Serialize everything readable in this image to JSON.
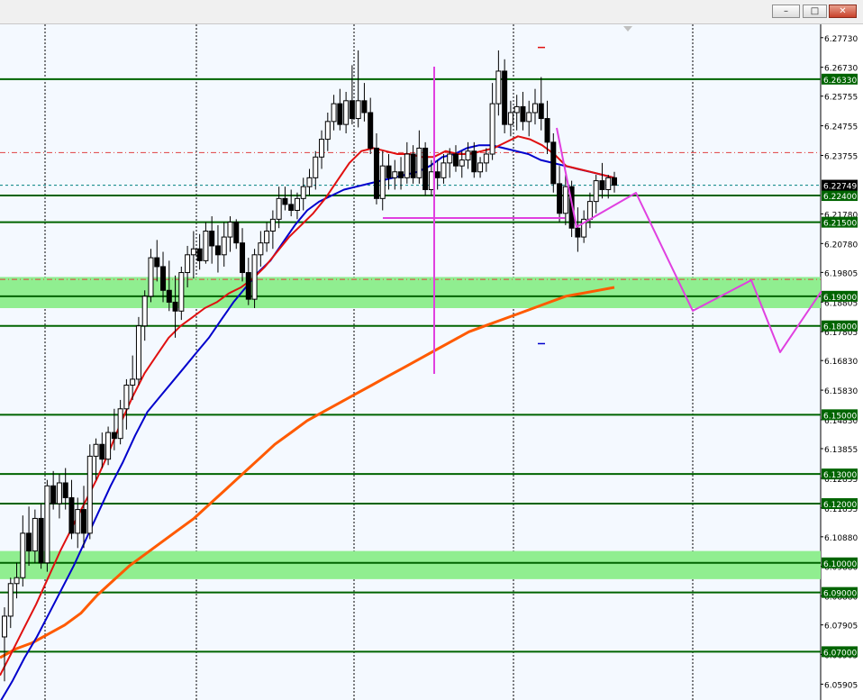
{
  "window": {
    "minimize_icon": "–",
    "maximize_icon": "□",
    "close_icon": "✕"
  },
  "colors": {
    "plot_bg": "#f4f9ff",
    "axis_bg": "#ffffff",
    "level_line": "#006400",
    "zone_fill": "#90ee90",
    "label_bg": "#006400",
    "label_text": "#ffffff",
    "ma_fast": "#e01010",
    "ma_mid": "#0000cc",
    "ma_slow": "#ff5a00",
    "projection": "#e040e0",
    "current_price_bg": "#000000"
  },
  "chart_data": {
    "type": "candlestick",
    "y_range": [
      6.0537,
      6.2818
    ],
    "price_ticks": [
      "6.27730",
      "6.26730",
      "6.25755",
      "6.24755",
      "6.23755",
      "6.21780",
      "6.20780",
      "6.19805",
      "6.18805",
      "6.17805",
      "6.16830",
      "6.15830",
      "6.14830",
      "6.13855",
      "6.12855",
      "6.11855",
      "6.10880",
      "6.09880",
      "6.08880",
      "6.07905",
      "6.06905",
      "6.05905"
    ],
    "levels": [
      {
        "price": 6.2633,
        "label": "6.26330"
      },
      {
        "price": 6.224,
        "label": "6.22400"
      },
      {
        "price": 6.215,
        "label": "6.21500"
      },
      {
        "price": 6.19,
        "label": "6.19000"
      },
      {
        "price": 6.18,
        "label": "6.18000"
      },
      {
        "price": 6.15,
        "label": "6.15000"
      },
      {
        "price": 6.13,
        "label": "6.13000"
      },
      {
        "price": 6.12,
        "label": "6.12000"
      },
      {
        "price": 6.1,
        "label": "6.10000"
      },
      {
        "price": 6.09,
        "label": "6.09000"
      },
      {
        "price": 6.07,
        "label": "6.07000"
      }
    ],
    "zones": [
      [
        6.186,
        6.1965
      ],
      [
        6.0945,
        6.104
      ]
    ],
    "current_price": {
      "price": 6.22749,
      "label": "6.22749"
    },
    "dash_levels": [
      6.2385,
      6.1957
    ],
    "candles": [
      [
        6.075,
        6.085,
        6.06,
        6.082
      ],
      [
        6.082,
        6.095,
        6.078,
        6.093
      ],
      [
        6.093,
        6.1,
        6.088,
        6.095
      ],
      [
        6.095,
        6.116,
        6.092,
        6.11
      ],
      [
        6.11,
        6.119,
        6.099,
        6.104
      ],
      [
        6.104,
        6.118,
        6.1,
        6.115
      ],
      [
        6.115,
        6.12,
        6.098,
        6.1
      ],
      [
        6.1,
        6.128,
        6.097,
        6.126
      ],
      [
        6.126,
        6.131,
        6.118,
        6.12
      ],
      [
        6.12,
        6.13,
        6.115,
        6.127
      ],
      [
        6.127,
        6.132,
        6.118,
        6.122
      ],
      [
        6.122,
        6.128,
        6.108,
        6.11
      ],
      [
        6.11,
        6.122,
        6.105,
        6.118
      ],
      [
        6.118,
        6.126,
        6.105,
        6.11
      ],
      [
        6.11,
        6.14,
        6.108,
        6.136
      ],
      [
        6.136,
        6.142,
        6.128,
        6.14
      ],
      [
        6.14,
        6.144,
        6.132,
        6.135
      ],
      [
        6.135,
        6.146,
        6.133,
        6.144
      ],
      [
        6.144,
        6.152,
        6.138,
        6.142
      ],
      [
        6.142,
        6.155,
        6.14,
        6.152
      ],
      [
        6.152,
        6.162,
        6.145,
        6.16
      ],
      [
        6.16,
        6.17,
        6.155,
        6.162
      ],
      [
        6.162,
        6.183,
        6.16,
        6.18
      ],
      [
        6.18,
        6.192,
        6.175,
        6.19
      ],
      [
        6.19,
        6.206,
        6.188,
        6.203
      ],
      [
        6.203,
        6.209,
        6.195,
        6.2
      ],
      [
        6.2,
        6.205,
        6.188,
        6.192
      ],
      [
        6.192,
        6.202,
        6.185,
        6.188
      ],
      [
        6.188,
        6.197,
        6.176,
        6.185
      ],
      [
        6.185,
        6.2,
        6.182,
        6.198
      ],
      [
        6.198,
        6.207,
        6.193,
        6.204
      ],
      [
        6.204,
        6.212,
        6.196,
        6.206
      ],
      [
        6.206,
        6.211,
        6.199,
        6.202
      ],
      [
        6.202,
        6.215,
        6.201,
        6.212
      ],
      [
        6.212,
        6.217,
        6.201,
        6.207
      ],
      [
        6.207,
        6.214,
        6.198,
        6.204
      ],
      [
        6.204,
        6.215,
        6.2,
        6.21
      ],
      [
        6.21,
        6.217,
        6.205,
        6.215
      ],
      [
        6.215,
        6.216,
        6.206,
        6.208
      ],
      [
        6.208,
        6.213,
        6.195,
        6.198
      ],
      [
        6.198,
        6.203,
        6.187,
        6.189
      ],
      [
        6.189,
        6.206,
        6.186,
        6.204
      ],
      [
        6.204,
        6.212,
        6.2,
        6.208
      ],
      [
        6.208,
        6.215,
        6.205,
        6.212
      ],
      [
        6.212,
        6.219,
        6.206,
        6.216
      ],
      [
        6.216,
        6.227,
        6.213,
        6.223
      ],
      [
        6.223,
        6.227,
        6.219,
        6.221
      ],
      [
        6.221,
        6.226,
        6.217,
        6.219
      ],
      [
        6.219,
        6.225,
        6.216,
        6.223
      ],
      [
        6.223,
        6.23,
        6.219,
        6.227
      ],
      [
        6.227,
        6.233,
        6.224,
        6.23
      ],
      [
        6.23,
        6.239,
        6.226,
        6.237
      ],
      [
        6.237,
        6.246,
        6.233,
        6.243
      ],
      [
        6.243,
        6.252,
        6.239,
        6.249
      ],
      [
        6.249,
        6.258,
        6.246,
        6.255
      ],
      [
        6.255,
        6.26,
        6.246,
        6.248
      ],
      [
        6.248,
        6.259,
        6.245,
        6.256
      ],
      [
        6.256,
        6.268,
        6.248,
        6.25
      ],
      [
        6.25,
        6.273,
        6.247,
        6.256
      ],
      [
        6.256,
        6.262,
        6.249,
        6.252
      ],
      [
        6.252,
        6.257,
        6.238,
        6.24
      ],
      [
        6.24,
        6.245,
        6.221,
        6.223
      ],
      [
        6.223,
        6.239,
        6.219,
        6.234
      ],
      [
        6.234,
        6.238,
        6.226,
        6.23
      ],
      [
        6.23,
        6.236,
        6.226,
        6.232
      ],
      [
        6.232,
        6.237,
        6.226,
        6.23
      ],
      [
        6.23,
        6.242,
        6.228,
        6.238
      ],
      [
        6.238,
        6.241,
        6.228,
        6.23
      ],
      [
        6.23,
        6.246,
        6.228,
        6.24
      ],
      [
        6.24,
        6.242,
        6.224,
        6.226
      ],
      [
        6.226,
        6.236,
        6.224,
        6.232
      ],
      [
        6.232,
        6.236,
        6.226,
        6.23
      ],
      [
        6.23,
        6.238,
        6.228,
        6.235
      ],
      [
        6.235,
        6.24,
        6.23,
        6.238
      ],
      [
        6.238,
        6.241,
        6.232,
        6.234
      ],
      [
        6.234,
        6.239,
        6.23,
        6.236
      ],
      [
        6.236,
        6.242,
        6.233,
        6.239
      ],
      [
        6.239,
        6.242,
        6.23,
        6.232
      ],
      [
        6.232,
        6.237,
        6.23,
        6.235
      ],
      [
        6.235,
        6.24,
        6.232,
        6.238
      ],
      [
        6.238,
        6.262,
        6.236,
        6.255
      ],
      [
        6.255,
        6.273,
        6.251,
        6.266
      ],
      [
        6.266,
        6.27,
        6.245,
        6.248
      ],
      [
        6.248,
        6.256,
        6.244,
        6.252
      ],
      [
        6.252,
        6.258,
        6.246,
        6.254
      ],
      [
        6.254,
        6.259,
        6.246,
        6.249
      ],
      [
        6.249,
        6.256,
        6.244,
        6.252
      ],
      [
        6.252,
        6.26,
        6.248,
        6.255
      ],
      [
        6.255,
        6.264,
        6.246,
        6.25
      ],
      [
        6.25,
        6.256,
        6.238,
        6.242
      ],
      [
        6.242,
        6.245,
        6.225,
        6.228
      ],
      [
        6.228,
        6.234,
        6.215,
        6.218
      ],
      [
        6.218,
        6.231,
        6.214,
        6.227
      ],
      [
        6.227,
        6.229,
        6.21,
        6.213
      ],
      [
        6.213,
        6.22,
        6.205,
        6.21
      ],
      [
        6.21,
        6.219,
        6.208,
        6.216
      ],
      [
        6.216,
        6.225,
        6.213,
        6.222
      ],
      [
        6.222,
        6.231,
        6.218,
        6.229
      ],
      [
        6.229,
        6.235,
        6.223,
        6.226
      ],
      [
        6.226,
        6.231,
        6.223,
        6.23
      ],
      [
        6.23,
        6.232,
        6.225,
        6.2275
      ]
    ],
    "ma_fast": [
      6.062,
      6.07,
      6.078,
      6.086,
      6.095,
      6.104,
      6.112,
      6.12,
      6.128,
      6.137,
      6.147,
      6.156,
      6.164,
      6.17,
      6.176,
      6.18,
      6.183,
      6.186,
      6.188,
      6.191,
      6.193,
      6.196,
      6.2,
      6.205,
      6.21,
      6.214,
      6.218,
      6.223,
      6.229,
      6.235,
      6.239,
      6.24,
      6.239,
      6.238,
      6.238,
      6.237,
      6.237,
      6.239,
      6.238,
      6.238,
      6.239,
      6.24,
      6.242,
      6.244,
      6.243,
      6.241,
      6.238,
      6.234,
      6.233,
      6.232,
      6.231,
      6.23
    ],
    "ma_mid": [
      6.053,
      6.06,
      6.068,
      6.075,
      6.083,
      6.091,
      6.099,
      6.108,
      6.117,
      6.126,
      6.134,
      6.143,
      6.151,
      6.156,
      6.161,
      6.166,
      6.171,
      6.176,
      6.182,
      6.188,
      6.193,
      6.198,
      6.202,
      6.208,
      6.214,
      6.219,
      6.222,
      6.224,
      6.226,
      6.227,
      6.228,
      6.229,
      6.23,
      6.231,
      6.232,
      6.234,
      6.237,
      6.238,
      6.24,
      6.241,
      6.241,
      6.24,
      6.239,
      6.238,
      6.236,
      6.235,
      6.234,
      6.233,
      6.232,
      6.231,
      6.23
    ],
    "ma_slow": [
      6.068,
      6.071,
      6.073,
      6.076,
      6.079,
      6.083,
      6.089,
      6.094,
      6.099,
      6.103,
      6.107,
      6.111,
      6.115,
      6.12,
      6.125,
      6.13,
      6.135,
      6.14,
      6.144,
      6.148,
      6.151,
      6.154,
      6.157,
      6.16,
      6.163,
      6.166,
      6.169,
      6.172,
      6.175,
      6.178,
      6.18,
      6.182,
      6.184,
      6.186,
      6.188,
      6.19,
      6.191,
      6.192,
      6.193
    ],
    "markers": [
      {
        "price": 6.274
      },
      {
        "price": 6.174
      }
    ]
  }
}
